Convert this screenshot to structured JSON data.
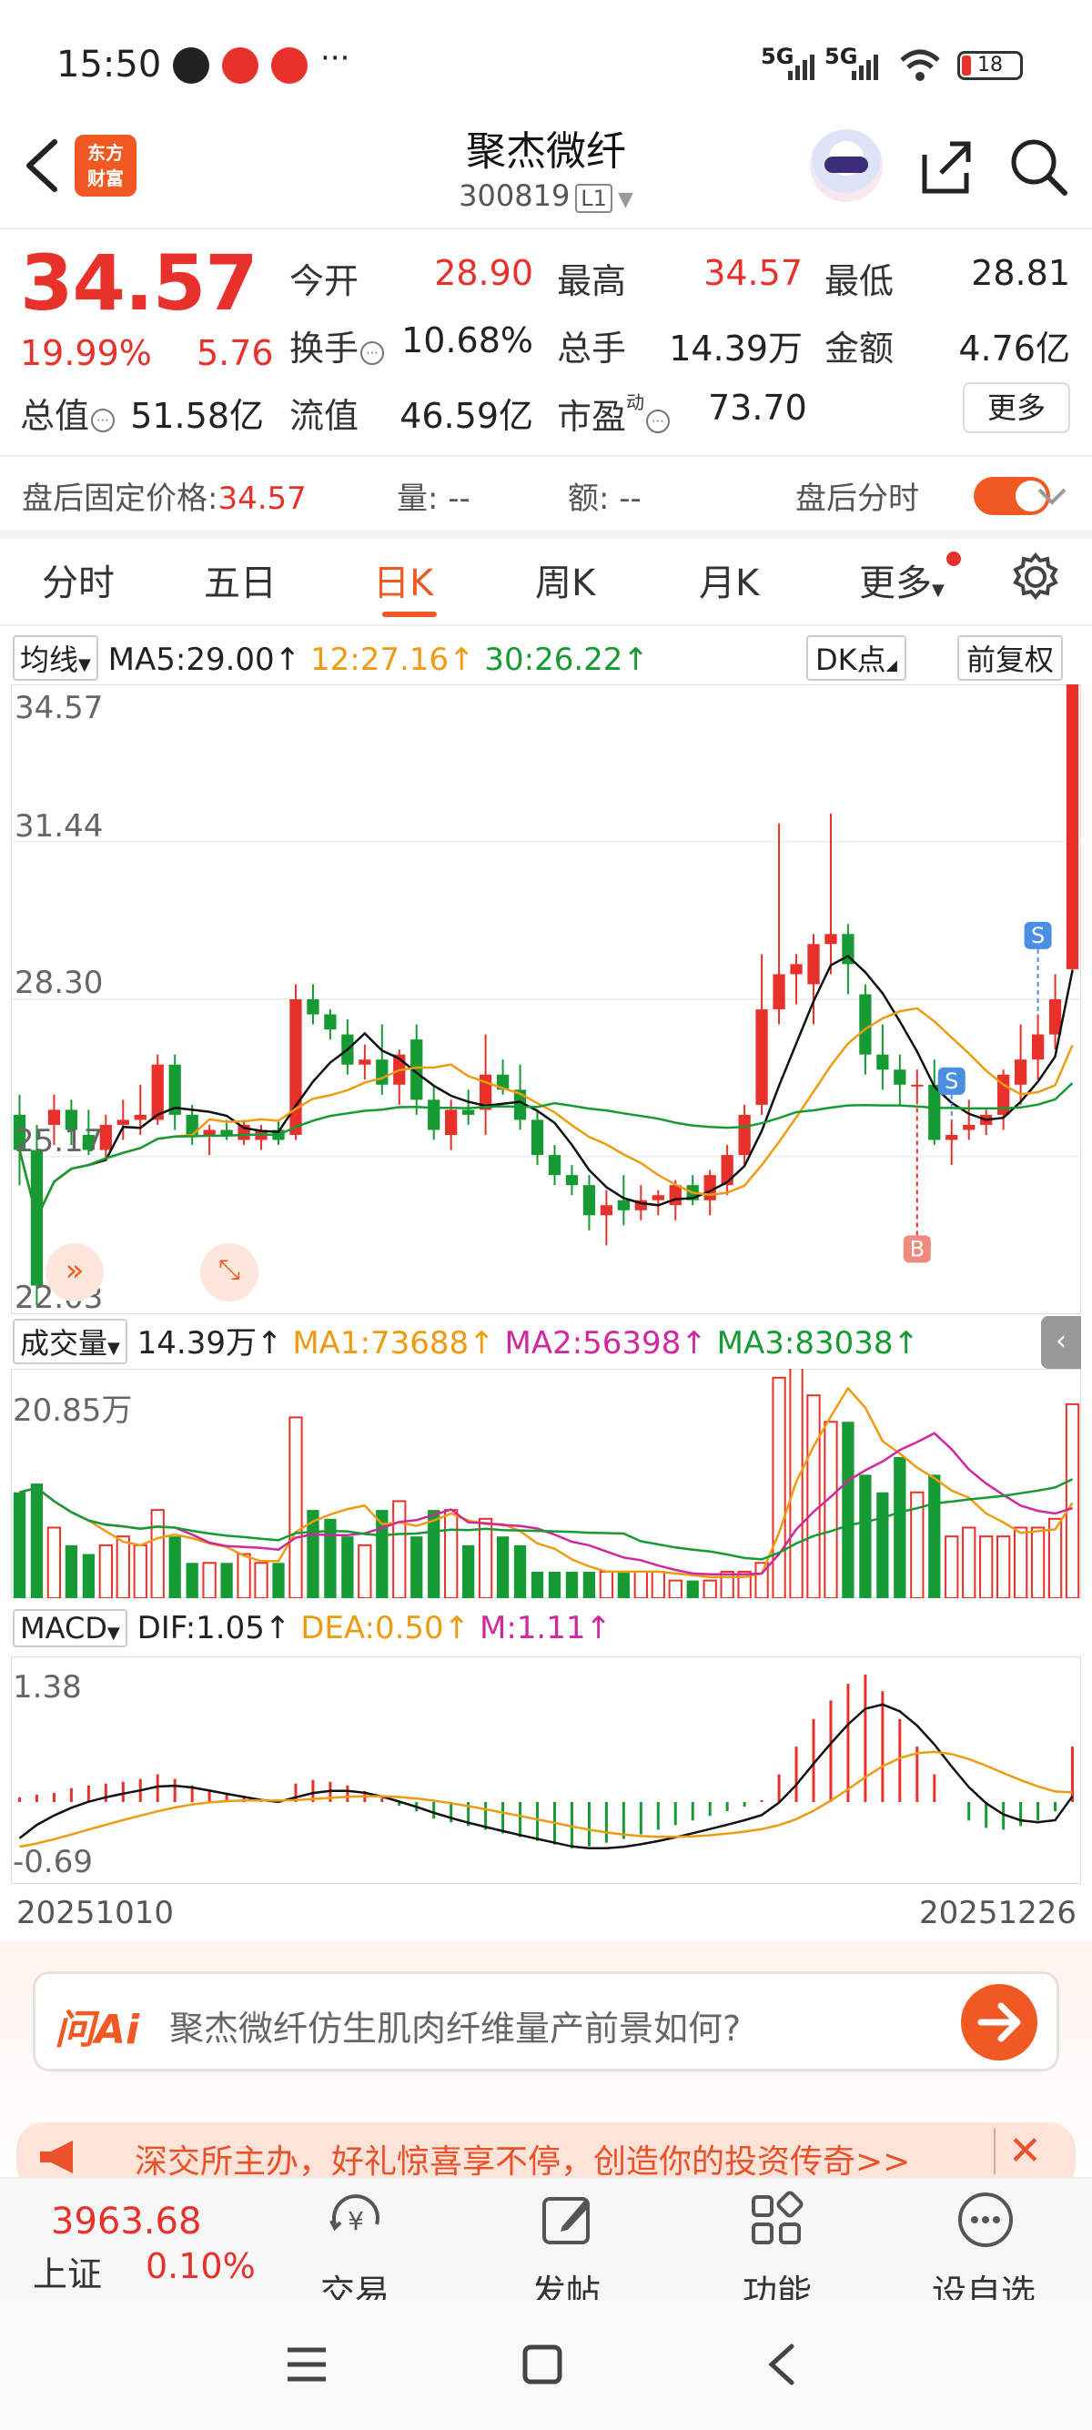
{
  "status_bar": {
    "time": "15:50",
    "net1": "5G",
    "net2": "5G",
    "battery": "18",
    "more": "···"
  },
  "header": {
    "app_logo_line1": "东方",
    "app_logo_line2": "财富",
    "title": "聚杰微纤",
    "code": "300819",
    "level": "L1"
  },
  "quote": {
    "price": "34.57",
    "change_pct": "19.99%",
    "change": "5.76",
    "rows": [
      [
        {
          "label": "今开",
          "value": "28.90",
          "color": "red"
        },
        {
          "label": "最高",
          "value": "34.57",
          "color": "red"
        },
        {
          "label": "最低",
          "value": "28.81",
          "color": "black"
        }
      ],
      [
        {
          "label": "换手",
          "value": "10.68%",
          "color": "black"
        },
        {
          "label": "总手",
          "value": "14.39万",
          "color": "black"
        },
        {
          "label": "金额",
          "value": "4.76亿",
          "color": "black"
        }
      ],
      [
        {
          "label": "总值",
          "value": "51.58亿",
          "color": "black"
        },
        {
          "label": "流值",
          "value": "46.59亿",
          "color": "black"
        },
        {
          "label": "市盈",
          "value": "73.70",
          "color": "black"
        }
      ]
    ],
    "pe_superscript": "动",
    "more_label": "更多"
  },
  "after_hours": {
    "label": "盘后固定价格:",
    "price": "34.57",
    "vol_label": "量: --",
    "amt_label": "额: --",
    "toggle_label": "盘后分时"
  },
  "tabs": [
    "分时",
    "五日",
    "日K",
    "周K",
    "月K",
    "更多"
  ],
  "active_tab": "日K",
  "kline_legend": {
    "selector": "均线",
    "ma5": "MA5:29.00",
    "ma10": "12:27.16",
    "ma30": "30:26.22",
    "dk_button": "DK点",
    "adjust_button": "前复权"
  },
  "kline_axis": {
    "top": "34.57",
    "mid1": "31.44",
    "mid2": "28.30",
    "mid3": "25.17",
    "bottom": "22.03"
  },
  "signals": {
    "s_label": "S",
    "b_label": "B"
  },
  "volume_legend": {
    "selector": "成交量",
    "vol": "14.39万",
    "ma1": "MA1:73688",
    "ma2": "MA2:56398",
    "ma3": "MA3:83038",
    "axis_top": "20.85万"
  },
  "macd_legend": {
    "selector": "MACD",
    "dif": "DIF:1.05",
    "dea": "DEA:0.50",
    "m": "M:1.11",
    "axis_top": "1.38",
    "axis_bottom": "-0.69"
  },
  "dates": {
    "start": "20251010",
    "end": "20251226"
  },
  "ai": {
    "logo": "问Ai",
    "prompt": "聚杰微纤仿生肌肉纤维量产前景如何?"
  },
  "banner": {
    "text": "深交所主办，好礼惊喜享不停，创造你的投资传奇>>"
  },
  "bottom_nav": {
    "index_value": "3963.68",
    "index_name": "上证",
    "index_change": "0.10%",
    "trade": "交易",
    "post": "发帖",
    "functions": "功能",
    "watchlist": "设自选"
  },
  "colors": {
    "up": "#e8312a",
    "down": "#169b34",
    "accent": "#f05a22",
    "ma10": "#ef9b12",
    "ma_line": "#d0289e"
  },
  "chart_data": {
    "type": "candlestick",
    "x_range": [
      "20251010",
      "20251226"
    ],
    "ylim": [
      22.03,
      34.57
    ],
    "candles": [
      {
        "o": 26.0,
        "h": 26.4,
        "l": 24.6,
        "c": 25.3
      },
      {
        "o": 25.3,
        "h": 25.8,
        "l": 22.2,
        "c": 22.6
      },
      {
        "o": 25.8,
        "h": 26.4,
        "l": 25.4,
        "c": 26.1
      },
      {
        "o": 26.1,
        "h": 26.3,
        "l": 25.4,
        "c": 25.7
      },
      {
        "o": 25.6,
        "h": 26.1,
        "l": 25.2,
        "c": 25.3
      },
      {
        "o": 25.3,
        "h": 26.0,
        "l": 25.1,
        "c": 25.8
      },
      {
        "o": 25.8,
        "h": 26.3,
        "l": 25.5,
        "c": 25.9
      },
      {
        "o": 25.9,
        "h": 26.6,
        "l": 25.6,
        "c": 26.0
      },
      {
        "o": 25.9,
        "h": 27.2,
        "l": 25.8,
        "c": 27.0
      },
      {
        "o": 27.0,
        "h": 27.2,
        "l": 25.7,
        "c": 26.0
      },
      {
        "o": 26.0,
        "h": 26.2,
        "l": 25.4,
        "c": 25.6
      },
      {
        "o": 25.6,
        "h": 25.8,
        "l": 25.2,
        "c": 25.7
      },
      {
        "o": 25.7,
        "h": 25.9,
        "l": 25.5,
        "c": 25.6
      },
      {
        "o": 25.5,
        "h": 25.9,
        "l": 25.4,
        "c": 25.8
      },
      {
        "o": 25.5,
        "h": 25.8,
        "l": 25.3,
        "c": 25.7
      },
      {
        "o": 25.7,
        "h": 25.9,
        "l": 25.4,
        "c": 25.5
      },
      {
        "o": 25.6,
        "h": 28.6,
        "l": 25.5,
        "c": 28.3
      },
      {
        "o": 28.3,
        "h": 28.6,
        "l": 27.8,
        "c": 28.0
      },
      {
        "o": 28.0,
        "h": 28.1,
        "l": 27.5,
        "c": 27.7
      },
      {
        "o": 27.6,
        "h": 27.9,
        "l": 26.8,
        "c": 27.0
      },
      {
        "o": 27.0,
        "h": 27.4,
        "l": 26.7,
        "c": 27.1
      },
      {
        "o": 27.1,
        "h": 27.8,
        "l": 26.4,
        "c": 26.6
      },
      {
        "o": 26.6,
        "h": 27.3,
        "l": 26.2,
        "c": 27.2
      },
      {
        "o": 27.5,
        "h": 27.8,
        "l": 26.0,
        "c": 26.3
      },
      {
        "o": 26.3,
        "h": 26.6,
        "l": 25.5,
        "c": 25.7
      },
      {
        "o": 25.6,
        "h": 26.3,
        "l": 25.3,
        "c": 26.1
      },
      {
        "o": 26.1,
        "h": 26.5,
        "l": 25.8,
        "c": 26.0
      },
      {
        "o": 26.1,
        "h": 27.6,
        "l": 25.6,
        "c": 26.8
      },
      {
        "o": 26.8,
        "h": 27.1,
        "l": 26.4,
        "c": 26.5
      },
      {
        "o": 26.5,
        "h": 27.0,
        "l": 25.7,
        "c": 25.9
      },
      {
        "o": 25.9,
        "h": 26.1,
        "l": 25.0,
        "c": 25.2
      },
      {
        "o": 25.2,
        "h": 25.4,
        "l": 24.6,
        "c": 24.8
      },
      {
        "o": 24.8,
        "h": 25.0,
        "l": 24.4,
        "c": 24.6
      },
      {
        "o": 24.6,
        "h": 24.8,
        "l": 23.7,
        "c": 24.0
      },
      {
        "o": 24.0,
        "h": 24.5,
        "l": 23.4,
        "c": 24.2
      },
      {
        "o": 24.3,
        "h": 24.8,
        "l": 23.8,
        "c": 24.1
      },
      {
        "o": 24.1,
        "h": 24.6,
        "l": 23.9,
        "c": 24.3
      },
      {
        "o": 24.3,
        "h": 24.5,
        "l": 24.0,
        "c": 24.4
      },
      {
        "o": 24.2,
        "h": 24.7,
        "l": 23.9,
        "c": 24.6
      },
      {
        "o": 24.6,
        "h": 24.8,
        "l": 24.2,
        "c": 24.3
      },
      {
        "o": 24.3,
        "h": 24.9,
        "l": 24.0,
        "c": 24.8
      },
      {
        "o": 24.6,
        "h": 25.4,
        "l": 24.4,
        "c": 25.2
      },
      {
        "o": 25.2,
        "h": 26.2,
        "l": 25.0,
        "c": 26.0
      },
      {
        "o": 26.2,
        "h": 29.2,
        "l": 26.0,
        "c": 28.1
      },
      {
        "o": 28.1,
        "h": 31.8,
        "l": 27.8,
        "c": 28.8
      },
      {
        "o": 28.8,
        "h": 29.2,
        "l": 28.2,
        "c": 29.0
      },
      {
        "o": 28.6,
        "h": 29.6,
        "l": 27.8,
        "c": 29.4
      },
      {
        "o": 29.4,
        "h": 32.0,
        "l": 28.8,
        "c": 29.6
      },
      {
        "o": 29.6,
        "h": 29.8,
        "l": 28.4,
        "c": 29.0
      },
      {
        "o": 28.4,
        "h": 28.6,
        "l": 26.8,
        "c": 27.2
      },
      {
        "o": 27.2,
        "h": 27.8,
        "l": 26.5,
        "c": 26.9
      },
      {
        "o": 26.9,
        "h": 27.2,
        "l": 26.2,
        "c": 26.6
      },
      {
        "o": 26.6,
        "h": 26.9,
        "l": 26.3,
        "c": 26.6
      },
      {
        "o": 26.6,
        "h": 27.1,
        "l": 25.4,
        "c": 25.5
      },
      {
        "o": 25.5,
        "h": 25.9,
        "l": 25.0,
        "c": 25.6
      },
      {
        "o": 25.7,
        "h": 26.3,
        "l": 25.5,
        "c": 25.8
      },
      {
        "o": 25.8,
        "h": 26.1,
        "l": 25.6,
        "c": 26.0
      },
      {
        "o": 26.0,
        "h": 26.9,
        "l": 25.7,
        "c": 26.8
      },
      {
        "o": 26.6,
        "h": 27.8,
        "l": 26.2,
        "c": 27.1
      },
      {
        "o": 27.1,
        "h": 28.0,
        "l": 26.7,
        "c": 27.6
      },
      {
        "o": 27.6,
        "h": 28.8,
        "l": 27.3,
        "c": 28.3
      },
      {
        "o": 28.9,
        "h": 34.57,
        "l": 28.81,
        "c": 34.57
      }
    ],
    "volume_ylim": [
      0,
      20.85
    ],
    "volumes": [
      12,
      13,
      8,
      6,
      5,
      6,
      7,
      6,
      10,
      7,
      4,
      4,
      4,
      5,
      4,
      4,
      20.5,
      10,
      9,
      7,
      6,
      10,
      11,
      7,
      10,
      10,
      6,
      9,
      7,
      6,
      3,
      3,
      3,
      3,
      3,
      3,
      3,
      3,
      2,
      2,
      2,
      3,
      3,
      4,
      25,
      31,
      23,
      20,
      20,
      14,
      12,
      16,
      12,
      14,
      7,
      8,
      7,
      7,
      8,
      8,
      9,
      22
    ],
    "macd_ylim": [
      -0.69,
      1.38
    ],
    "macd": [
      0.05,
      0.08,
      0.1,
      0.15,
      0.18,
      0.2,
      0.22,
      0.25,
      0.3,
      0.25,
      0.18,
      0.12,
      0.08,
      0.05,
      0.02,
      0.02,
      0.2,
      0.24,
      0.22,
      0.18,
      0.12,
      0.04,
      -0.04,
      -0.1,
      -0.18,
      -0.22,
      -0.26,
      -0.3,
      -0.34,
      -0.38,
      -0.42,
      -0.46,
      -0.5,
      -0.48,
      -0.44,
      -0.4,
      -0.35,
      -0.3,
      -0.25,
      -0.2,
      -0.15,
      -0.1,
      -0.05,
      0.02,
      0.3,
      0.6,
      0.9,
      1.1,
      1.28,
      1.38,
      1.2,
      0.9,
      0.6,
      0.3,
      0.0,
      -0.2,
      -0.28,
      -0.3,
      -0.26,
      -0.2,
      -0.1,
      0.6
    ]
  }
}
